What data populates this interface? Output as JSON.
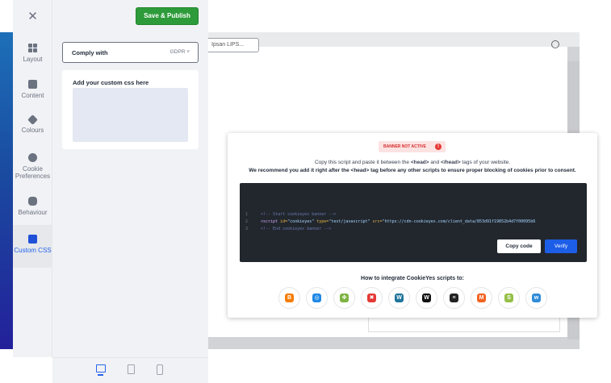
{
  "sidebar": {
    "close_icon": "close-icon",
    "items": [
      {
        "label": "Layout",
        "icon": "layout-icon"
      },
      {
        "label": "Content",
        "icon": "content-icon"
      },
      {
        "label": "Colours",
        "icon": "colours-icon"
      },
      {
        "label": "Cookie Preferences",
        "icon": "cookie-preferences-icon"
      },
      {
        "label": "Behaviour",
        "icon": "behaviour-icon"
      },
      {
        "label": "Custom CSS",
        "icon": "custom-css-icon",
        "active": true
      }
    ]
  },
  "toolbar": {
    "save_label": "Save & Publish"
  },
  "settings": {
    "comply_label": "Comply with",
    "comply_value": "GDPR ˅",
    "css_title": "Add your custom css here",
    "css_value": ""
  },
  "preview": {
    "tab_label": "Ipsan LIPS..."
  },
  "modal": {
    "badge": "BANNER NOT ACTIVE",
    "badge_icon": "!",
    "line1_pre": "Copy this script and paste it between the ",
    "line1_head": "<head>",
    "line1_mid": " and ",
    "line1_endhead": "</head>",
    "line1_post": " tags of your website.",
    "line2": "We recommend you add it right after the <head> tag before any other scripts to ensure proper blocking of cookies prior to consent.",
    "code": [
      {
        "num": "1",
        "text": "<!-- Start cookieyes banner -->"
      },
      {
        "num": "2",
        "tag_open": "<script ",
        "attr1": "id=",
        "val1": "\"cookieyes\"",
        "attr2": " type=",
        "val2": "\"text/javascript\"",
        "attr3": " src=",
        "val3": "\"https://cdn-cookieyes.com/client_data/853d91f19852b4d7f00095b6"
      },
      {
        "num": "3",
        "text": "<!-- End cookieyes banner -->"
      }
    ],
    "copy_label": "Copy code",
    "verify_label": "Verify",
    "integrate_title": "How to integrate CookieYes scripts to:",
    "integrations": [
      {
        "name": "blogger-icon",
        "glyph": "B",
        "color": "#f57c00"
      },
      {
        "name": "squarespace-icon-1",
        "glyph": "◎",
        "color": "#1e88e5"
      },
      {
        "name": "joomla-icon-1",
        "glyph": "✤",
        "color": "#7cb342"
      },
      {
        "name": "joomla-icon",
        "glyph": "✖",
        "color": "#e53935"
      },
      {
        "name": "wordpress-icon",
        "glyph": "W",
        "color": "#21759b"
      },
      {
        "name": "wix-icon",
        "glyph": "W",
        "color": "#111111"
      },
      {
        "name": "squarespace-icon",
        "glyph": "≡",
        "color": "#222222"
      },
      {
        "name": "magento-icon",
        "glyph": "M",
        "color": "#f26322"
      },
      {
        "name": "shopify-icon",
        "glyph": "S",
        "color": "#95bf47"
      },
      {
        "name": "weebly-icon",
        "glyph": "w",
        "color": "#2f8cd8"
      }
    ]
  }
}
